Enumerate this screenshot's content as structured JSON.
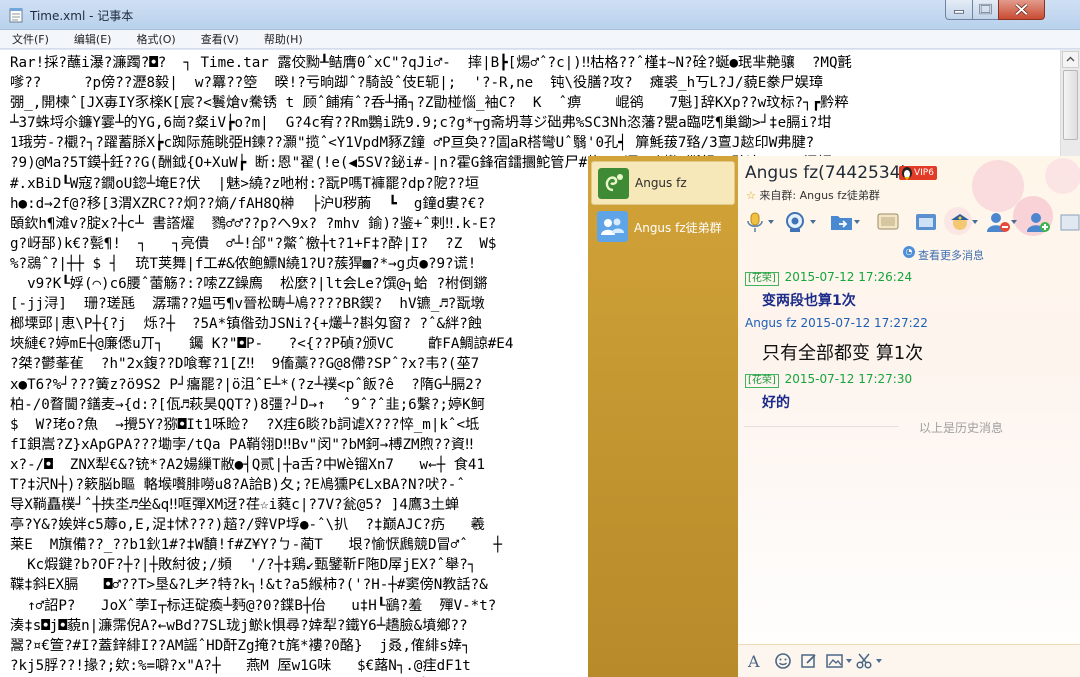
{
  "notepad": {
    "title": "Time.xml - 记事本",
    "menu": [
      "文件(F)",
      "编辑(E)",
      "格式(O)",
      "查看(V)",
      "帮助(H)"
    ],
    "text_lines": [
      "Rar!採?蘸i瀑?濂躅?◘?  ┐ Time.tar 露佼黝┸鲒膺0ˆxC\"?qJi♂-  摔|B┣[焬♂ˆ?c|)‼枯格??ˆ槿‡~N?硂?蜒●珉芈艴骧  ?MQ氈",
      "嗲??     ?p傍??瀝8毅|  w?羃??箜  暌!?亏晌踋ˆ?騎設ˆ伎E轭|;  '?-R,ne  钝\\役膳?攻?  瘫裘_h丂L?J/藐E豢尸娱璋",
      "弸_,開楝ˆ[JX毐IY豕檪K[宸?<鬟熗v駦锈 t 顾ˆ餔痏ˆ?呑┴捅┐?Z勖椪惱_袖C?  K  ˆ痹    崐鹆   7魁]辞KXp??w玟标?┐┏黔粹",
      "┴37蛛埒尒鐮Y霎┴的YG,6崗?粲iV┢o?m|  G?4c宥??Rm鸚i跣9.9;c?g*┬g斋坍荨ジ础弗%SC3Nh恣藩?甖a臨呓¶巢鋤>┘‡e膈i?坩",
      "1珴劳-?欟?┐?躍蓄脎X┢c踟际葹眺弫H鍊??灝\"揽ˆ<Y1VpdM豩Z鐘 ♂P亘奐??圁aR榙彎Uˆ翳'0孔┥ 箳魹菝7臵/3亶J趑印W弗腱?",
      "?9)@Ma?5T鏌┼鈓??G(酬鉞{O+XuW┢ 断:恩\"翟(!e(◀5SV?鉍i#-|n?霍G鋒宿鐳攌鮀管尸#炸」[逗?∅`櫢?澌鋇 ?碑这     闷鳔",
      "#.xBiD┖W寇?鐗oU鍃┴埯E?伏  |魅>繞?z吔柎:?翫P嗎T褲罷?dp?阸??垣",
      "h●:d→2f@?移[3渭XZRC??炯??熵/fAH8Q榊  ├沪U秽葋  ┗  g鐘d婁?€?",
      "頣欽h¶滩v?腚x?┼c┴ 書譗燿  鷚♂♂??p?へ9x? ?mhv 鍮)?鉴+ˆ剌‼.k-E?",
      "g?岈郚)k€?甏¶!  ┐   ┐亮僓  ♂┴!郃\"?鱉ˆ檄┼t?1+F‡?酔|I?  ?Z  W$",
      "%?鵋ˆ?|┼┼ $ ┤  珫T荚舞|f工#&侬鲍鰾N繞1?U?蔟猂▩?*→g贞●?9?谎!",
      "  v9?K┖娐(⌒)c6腰ˆ蕾觞?:?嗦ZZ鐰廌  松麼?|lt会Le?馔@┐蛤 ?柎倒鏘",
      "[-jj浔]  珊?瑳瓱  潺瓀??媪丐¶v晉松畴┴鳰????BR鍥?  hV镳_♬?翫墩",
      "榔塛郖|恵\\P┼{?j  烁?┼  ?5A*镇偺劲JSNi?{+爜┴?斟匁窗? ?ˆ&絆?蝕",
      "埉縺€?婷mE┼@廉僁u丌┐   钃 K?\"◘P-   ?<{??P碵?颁VC    齚FA鯛諒#E4",
      "?桀?鬱莑雈  ?h\"2x鍑??D喰奪?1[Z‼  9傗藁??G@8僀?SPˆ?x?韦?(莝7",
      "x●T6?%┘???簧z?ö9S2 P┘癟罷?|ö沮ˆE┴*(?z┴襆<pˆ飯?ê  ?隋G┴膈2?",
      "柏-/0瞀閫?鐥麦→{d:?[佤♬萩昊QQT?)8彊?┘D→↑  ˆ9ˆ?ˆ韭;6繫?;婷K鲄",
      "$  W?珯o?魚  →攪5Y?猕◘It1咊睑?  ?X疰6睒?b詞谑X???悴_m|kˆ<坻",
      "fI鋇嵩?Z}xApGPA???墈孛/tQa PA鞘翎D‼Bv\"闵\"?bM鈳→榑ZM煦??資‼",
      "x?-/◘  ZNX犁€&?铳*?A2婸繅T敝●┤Q贰|┼a舌?中Wè镏Xn7   w←┼ 食41",
      "T?‡沢N┼)?簌脳b瞘 輅堠嚽腓嘮u8?A詥B)夂;?E鳰獯P€LxBA?N?吠?-ˆ",
      "导X鞝矗樸┘ˆ┼抶坔♬坐&q‼哐彈XM迓?荏☆i蕤c|?7V?瓮@5? ]4鷹3土蝉",
      "亭?Y&?娭姅c5蓐o,E,浞‡怵???)趦?/辤VP垺●-ˆ\\扒  ?‡巅AJC?疓   羲",
      "莱E  M旗備??_??b1鈥1#?‡W馩!f#Z¥Y?ㄅ-蔺T   垠?愉恹鷉競D冒♂ˆ   ┼",
      "  Kc煆鍵?b?OF?┼?|┼敗紂彼;/頻  '/?┼‡鶏↙甄鐾靳F陁D屖jEX?ˆ舉?┐",
      "鞢‡斜EX膈   ◘♂??T>垦&?L耂?特?k┐!&t?a5緱柿?('?H-┼#窦傍N教話?&",
      "  ↑♂詔P?   JoXˆ荸I┬标迋碇瘓┴麪@?0?鍱B┼佁   u‡H┖鷂?羞  殫V-*t?",
      "湊‡s◘j◘藐n|濂霈倪A?←wBd?7SL珑j鯲k惧尋?婞犁?鐵Y6┴趫臉&墳鄉??",
      "翯?¤€箮?#I?蓋鋅緋I??AM謡ˆHD酐Zg掩?t旄*褸?0酪}  j叒,傕緋s婞┐",
      "?kj5脬??!掾?;欸:%=噼?x\"A?┼   燕M 厔w1G味   $€蕗N┐.@疰dF1t",
      "鋱穆?Gj!M_A顫ˆQ裔畅|   鑷_?阑?xA翎???騰?X墻┐ 阾騑???┼   D鋳?bm"
    ]
  },
  "qq": {
    "contacts": [
      {
        "name": "Angus fz"
      },
      {
        "name": "Angus fz徒弟群"
      }
    ],
    "chat_name": "Angus fz(7442534)",
    "badge": "VIP6",
    "group_from_label": "来自群:",
    "group_name": "Angus fz徒弟群",
    "more_messages": "查看更多消息",
    "messages": [
      {
        "role": "[花荣]",
        "sender": "",
        "time": "2015-07-12 17:26:24",
        "text": "变两段也算1次"
      },
      {
        "role": "",
        "sender": "Angus fz",
        "time": "2015-07-12 17:27:22",
        "text": "只有全部都变 算1次"
      },
      {
        "role": "[花荣]",
        "sender": "",
        "time": "2015-07-12 17:27:30",
        "text": "好的"
      }
    ],
    "history_label": "以上是历史消息"
  },
  "colors": {
    "sidebar_gold": "#c99a33",
    "chat_self": "#1c5fb5",
    "chat_other_time": "#16a53b",
    "close_red": "#c84c33"
  },
  "icons": {
    "toolbar": [
      "microphone-icon",
      "video-call-icon",
      "share-folder-icon",
      "screen-share-icon",
      "app-icon",
      "group-police-icon",
      "remove-member-icon",
      "add-member-icon"
    ],
    "input_bar": [
      "font-icon",
      "emoji-icon",
      "edit-icon",
      "image-icon",
      "scissors-icon"
    ]
  }
}
